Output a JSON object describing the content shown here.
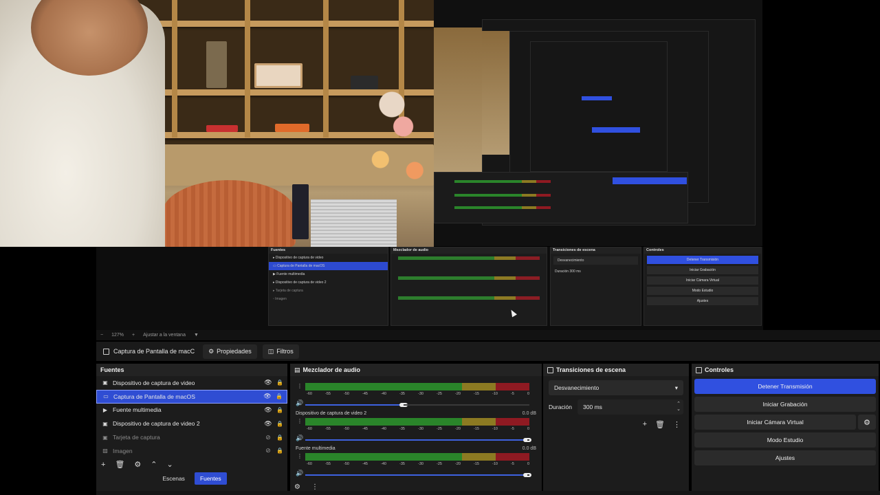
{
  "zoom_bar": {
    "minus": "−",
    "zoom": "127%",
    "plus": "+",
    "fit": "Ajustar a la ventana",
    "chevron": "▼"
  },
  "context_bar": {
    "source_name": "Captura de Pantalla de macC",
    "properties_label": "Propiedades",
    "filters_label": "Filtros"
  },
  "sources": {
    "title": "Fuentes",
    "items": [
      {
        "label": "Dispositivo de captura de video",
        "icon": "camera-icon",
        "visible": true,
        "locked": true,
        "selected": false
      },
      {
        "label": "Captura de Pantalla de macOS",
        "icon": "monitor-icon",
        "visible": true,
        "locked": true,
        "selected": true
      },
      {
        "label": "Fuente multimedia",
        "icon": "play-icon",
        "visible": true,
        "locked": true,
        "selected": false
      },
      {
        "label": "Dispositivo de captura de video 2",
        "icon": "camera-icon",
        "visible": true,
        "locked": true,
        "selected": false
      },
      {
        "label": "Tarjeta de captura",
        "icon": "camera-icon",
        "visible": false,
        "locked": true,
        "selected": false
      },
      {
        "label": "Imagen",
        "icon": "image-icon",
        "visible": false,
        "locked": true,
        "selected": false
      }
    ],
    "tabs": [
      "Escenas",
      "Fuentes"
    ],
    "active_tab": "Fuentes"
  },
  "mixer": {
    "title": "Mezclador de audio",
    "ticks": [
      "-60",
      "-55",
      "-50",
      "-45",
      "-40",
      "-35",
      "-30",
      "-25",
      "-20",
      "-15",
      "-10",
      "-5",
      "0"
    ],
    "channels": [
      {
        "name": "",
        "db": "",
        "fader": 0.44
      },
      {
        "name": "Dispositivo de captura de video 2",
        "db": "0.0 dB",
        "fader": 0.99
      },
      {
        "name": "Fuente multimedia",
        "db": "0.0 dB",
        "fader": 0.99
      }
    ]
  },
  "transitions": {
    "title": "Transiciones de escena",
    "selected": "Desvanecimiento",
    "duration_label": "Duración",
    "duration_value": "300 ms"
  },
  "controls": {
    "title": "Controles",
    "buttons": [
      "Detener Transmisión",
      "Iniciar Grabación",
      "Iniciar Cámara Virtual",
      "Modo Estudio",
      "Ajustes"
    ]
  },
  "colors": {
    "accent": "#3050e0",
    "panel": "#1c1c1c",
    "meter_green": "#2a852a",
    "meter_yellow": "#8c7a22",
    "meter_red": "#8f1a22"
  }
}
